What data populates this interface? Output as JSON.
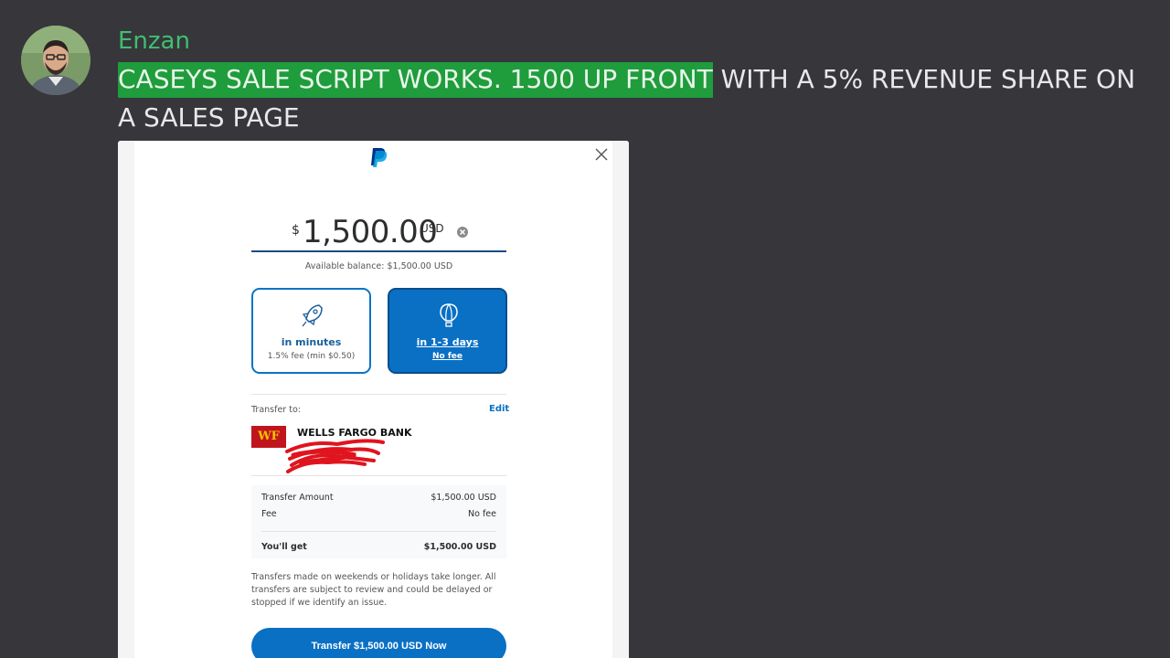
{
  "message": {
    "username": "Enzan",
    "text_highlighted": "CASEYS SALE SCRIPT WORKS. 1500 UP FRONT",
    "text_rest": " WITH A 5% REVENUE SHARE ON A SALES PAGE",
    "highlight_color": "#1f9c3c",
    "username_color": "#3fbf6f"
  },
  "paypal": {
    "currency_symbol": "$",
    "amount": "1,500.00",
    "currency_code": "USD",
    "available_balance": "Available balance: $1,500.00 USD",
    "options": [
      {
        "title": "in minutes",
        "subtitle": "1.5% fee (min $0.50)",
        "icon": "rocket-icon",
        "selected": false
      },
      {
        "title": "in 1-3 days",
        "subtitle": "No fee",
        "icon": "balloon-icon",
        "selected": true
      }
    ],
    "transfer_to_label": "Transfer to:",
    "edit_label": "Edit",
    "bank_logo_text": "WF",
    "bank_name": "WELLS FARGO BANK",
    "summary": {
      "transfer_amount_label": "Transfer Amount",
      "transfer_amount_value": "$1,500.00 USD",
      "fee_label": "Fee",
      "fee_value": "No fee",
      "you_get_label": "You'll get",
      "you_get_value": "$1,500.00 USD"
    },
    "disclaimer": "Transfers made on weekends or holidays take longer. All transfers are subject to review and could be delayed or stopped if we identify an issue.",
    "cta_label": "Transfer $1,500.00 USD Now",
    "accent_color": "#0a70c4"
  }
}
